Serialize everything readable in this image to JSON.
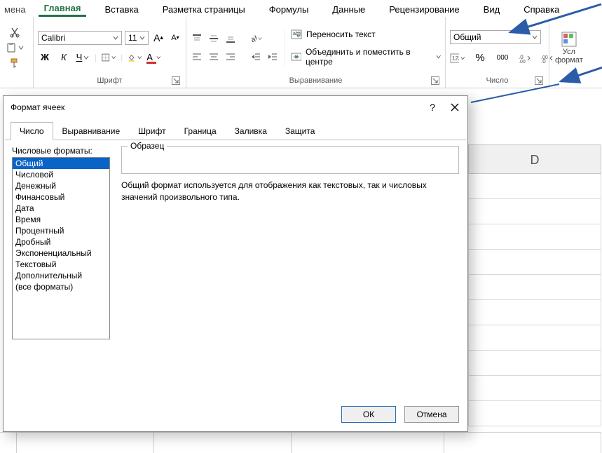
{
  "ribbon": {
    "mena_partial": "мена",
    "tabs": {
      "home": "Главная",
      "insert": "Вставка",
      "page_layout": "Разметка страницы",
      "formulas": "Формулы",
      "data": "Данные",
      "review": "Рецензирование",
      "view": "Вид",
      "help": "Справка"
    },
    "font": {
      "name": "Calibri",
      "size": "11",
      "group_label": "Шрифт",
      "bold": "Ж",
      "italic": "К",
      "underline": "Ч"
    },
    "align": {
      "wrap": "Переносить текст",
      "merge": "Объединить и поместить в центре",
      "group_label": "Выравнивание"
    },
    "number": {
      "selected": "Общий",
      "percent_icon": "%",
      "thousands_icon": "000",
      "group_label": "Число"
    },
    "cond": {
      "line1": "Усл",
      "line2": "формат"
    }
  },
  "sheet": {
    "col_d": "D"
  },
  "dialog": {
    "title": "Формат ячеек",
    "help": "?",
    "tabs": {
      "number": "Число",
      "alignment": "Выравнивание",
      "font": "Шрифт",
      "border": "Граница",
      "fill": "Заливка",
      "protection": "Защита"
    },
    "list_label": "Числовые форматы:",
    "formats": [
      "Общий",
      "Числовой",
      "Денежный",
      "Финансовый",
      "Дата",
      "Время",
      "Процентный",
      "Дробный",
      "Экспоненциальный",
      "Текстовый",
      "Дополнительный",
      "(все форматы)"
    ],
    "sample_label": "Образец",
    "description": "Общий формат используется для отображения как текстовых, так и числовых значений произвольного типа.",
    "ok": "ОК",
    "cancel": "Отмена"
  }
}
